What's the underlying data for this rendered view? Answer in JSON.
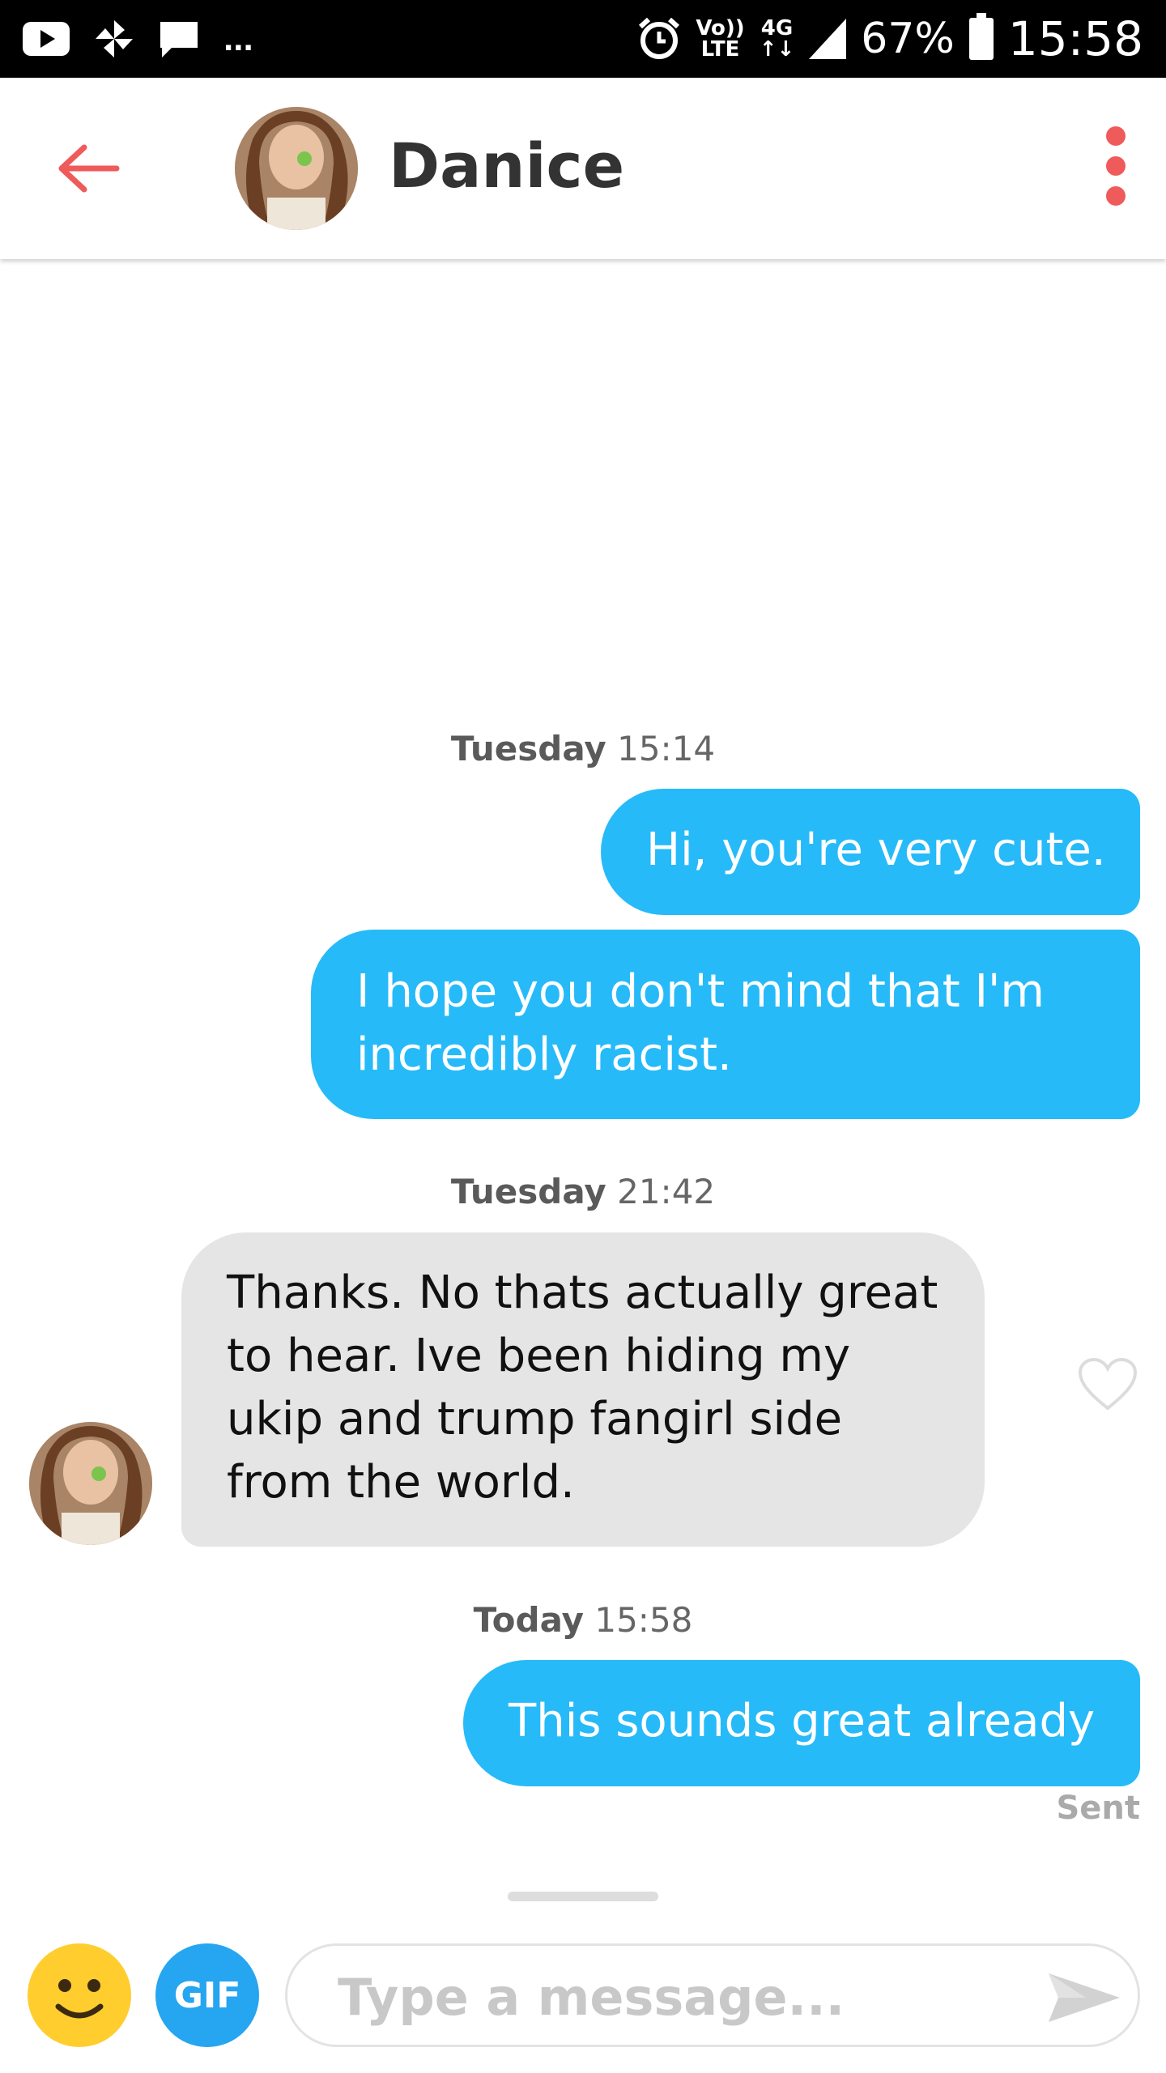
{
  "status_bar": {
    "overflow_dots": "...",
    "volte_top": "Vo))",
    "volte_bottom": "LTE",
    "network_top": "4G",
    "network_bottom": "↑↓",
    "battery": "67%",
    "time": "15:58",
    "icons": [
      "youtube-icon",
      "pinwheel-icon",
      "message-icon",
      "alarm-icon",
      "signal-icon",
      "battery-icon"
    ]
  },
  "header": {
    "contact_name": "Danice",
    "back_icon": "arrow-left-icon",
    "menu_icon": "kebab-menu-icon",
    "accent_color": "#ef5a5a"
  },
  "messages": [
    {
      "type": "timestamp",
      "day": "Tuesday",
      "time": "15:14"
    },
    {
      "type": "outgoing",
      "text": "Hi, you're very cute."
    },
    {
      "type": "outgoing",
      "line1": "I hope you don't mind that I'm",
      "line2": "incredibly racist."
    },
    {
      "type": "timestamp",
      "day": "Tuesday",
      "time": "21:42"
    },
    {
      "type": "incoming",
      "line1": "Thanks. No thats actually great",
      "line2": "to hear. Ive been hiding my",
      "line3": "ukip and trump fangirl side",
      "line4": "from the world."
    },
    {
      "type": "timestamp",
      "day": "Today",
      "time": "15:58"
    },
    {
      "type": "outgoing",
      "text": "This sounds great already",
      "status": "Sent"
    }
  ],
  "composer": {
    "placeholder": "Type a message...",
    "gif_label": "GIF",
    "emoji_icon": "smiley-icon",
    "send_icon": "send-icon"
  },
  "colors": {
    "outgoing_bubble": "#26baf9",
    "incoming_bubble": "#e5e5e5",
    "gif_button": "#26a5f0",
    "emoji_button": "#ffcd2e"
  }
}
